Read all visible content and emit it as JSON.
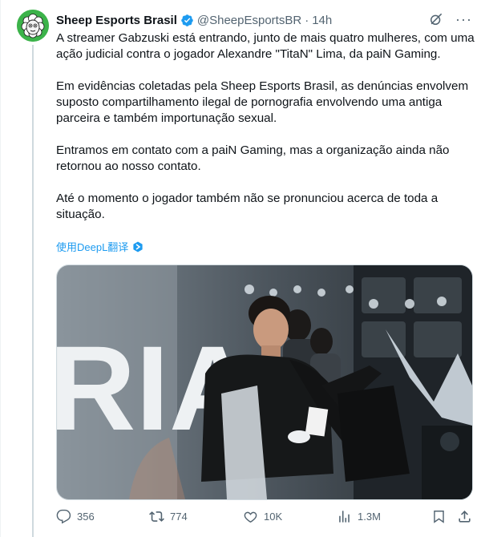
{
  "tweet": {
    "author_name": "Sheep Esports Brasil",
    "handle": "@SheepEsportsBR",
    "separator": "·",
    "time": "14h",
    "paragraphs": [
      "A streamer Gabzuski está entrando, junto de mais quatro mulheres, com uma ação judicial contra o jogador Alexandre \"TitaN\" Lima, da paiN Gaming.",
      "Em evidências coletadas pela Sheep Esports Brasil, as denúncias envolvem suposto compartilhamento ilegal de pornografia envolvendo uma antiga parceira e também importunação sexual.",
      "Entramos em contato com a paiN Gaming, mas a organização ainda não retornou ao nosso contato.",
      "Até o momento o jogador também não se pronunciou acerca de toda a situação."
    ],
    "translate_label": "使用DeepL翻译",
    "media_text": "RIA",
    "stats": {
      "replies": "356",
      "reposts": "774",
      "likes": "10K",
      "views": "1.3M"
    }
  },
  "colors": {
    "accent": "#1d9bf0",
    "text": "#0f1419",
    "muted": "#536471",
    "avatar_bg": "#3cb34a"
  },
  "icons": [
    "avatar-sheep",
    "verified-badge-icon",
    "grok-icon",
    "more-icon",
    "translate-icon",
    "reply-icon",
    "repost-icon",
    "like-icon",
    "views-icon",
    "bookmark-icon",
    "share-icon"
  ]
}
